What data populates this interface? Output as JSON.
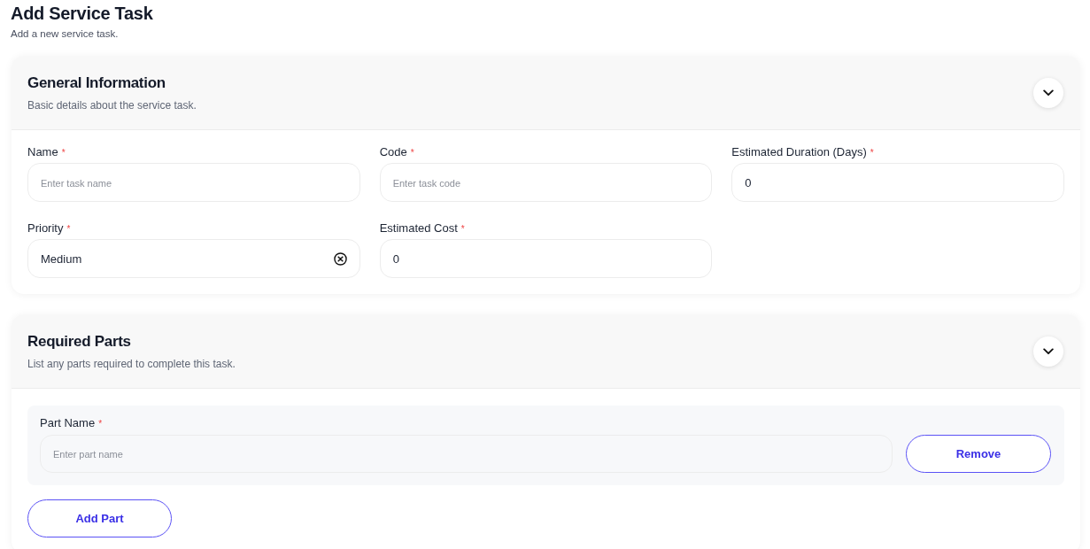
{
  "page": {
    "title": "Add Service Task",
    "subtitle": "Add a new service task."
  },
  "sections": [
    {
      "kind": "fields",
      "title": "General Information",
      "subtitle": "Basic details about the service task.",
      "fields": [
        {
          "kind": "text",
          "label": "Name",
          "required_mark": "*",
          "placeholder": "Enter task name"
        },
        {
          "kind": "text",
          "label": "Code",
          "required_mark": "*",
          "placeholder": "Enter task code"
        },
        {
          "kind": "text",
          "label": "Estimated Duration (Days)",
          "required_mark": "*",
          "value": "0"
        },
        {
          "kind": "select",
          "label": "Priority",
          "required_mark": "*",
          "value": "Medium"
        },
        {
          "kind": "text",
          "label": "Estimated Cost",
          "required_mark": "*",
          "value": "0"
        }
      ]
    },
    {
      "kind": "parts",
      "title": "Required Parts",
      "subtitle": "List any parts required to complete this task.",
      "parts": [
        {
          "label": "Part Name",
          "required_mark": "*",
          "placeholder": "Enter part name",
          "remove_label": "Remove"
        }
      ],
      "add_label": "Add Part"
    }
  ]
}
